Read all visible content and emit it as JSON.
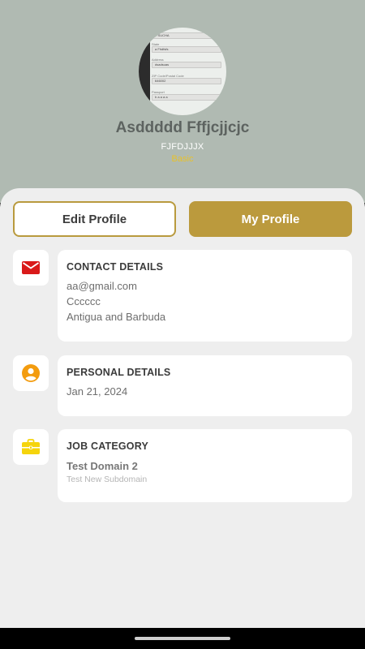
{
  "profile": {
    "name": "Asddddd Fffjcjjcjc",
    "code": "FJFDJJJX",
    "plan": "Basic"
  },
  "avatar_form": {
    "rows": [
      {
        "label": "",
        "value": "F SUCHA"
      },
      {
        "label": "State",
        "value": "a Fhdfsfs"
      },
      {
        "label": "Address",
        "value": "dsadsuas"
      },
      {
        "label": "ZIP Code/Postal Code",
        "value": "646002"
      },
      {
        "label": "Passport",
        "value": "h a a a a"
      }
    ]
  },
  "buttons": {
    "edit_profile": "Edit Profile",
    "my_profile": "My Profile"
  },
  "contact": {
    "title": "CONTACT DETAILS",
    "email": "aa@gmail.com",
    "line2": "Cccccc",
    "country": "Antigua and Barbuda",
    "icon": "mail-icon",
    "icon_color": "#d91a1a"
  },
  "personal": {
    "title": "PERSONAL DETAILS",
    "date": "Jan 21, 2024",
    "icon": "person-icon",
    "icon_color": "#f39c0f"
  },
  "job": {
    "title": "JOB CATEGORY",
    "domain": "Test Domain 2",
    "subdomain": "Test New Subdomain",
    "icon": "briefcase-icon",
    "icon_color": "#f5d40c"
  },
  "colors": {
    "header_bg": "#b0bab2",
    "accent_gold": "#bb9a3d",
    "plan_yellow": "#e8c22a"
  }
}
